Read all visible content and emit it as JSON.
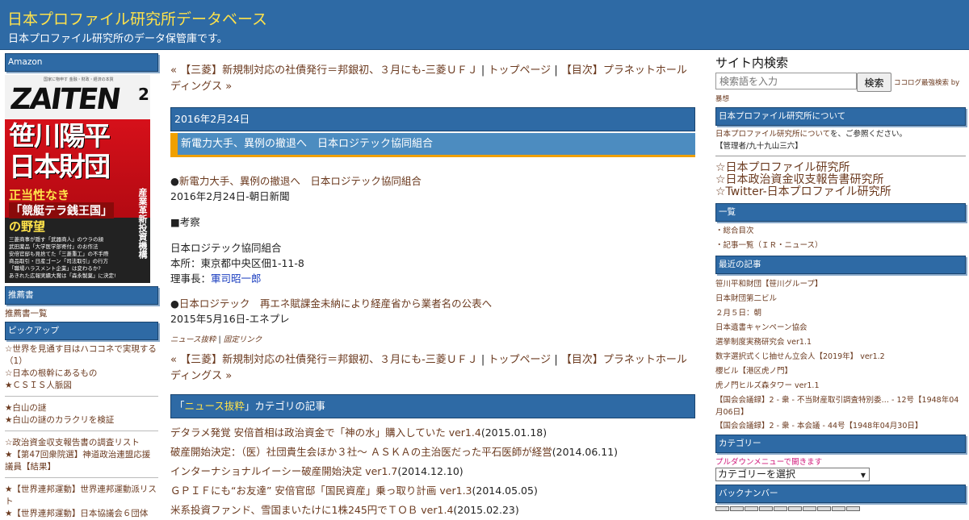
{
  "header": {
    "title": "日本プロファイル研究所データベース",
    "description": "日本プロファイル研究所のデータ保管庫です。"
  },
  "left": {
    "amazon_heading": "Amazon",
    "book": {
      "masthead": "ZAITEN",
      "masthead_small": "国家に物申す 金融・財政・経済の本質",
      "issue": "2",
      "headline1": "笹川陽平",
      "headline2": "日本財団",
      "sub1": "正当性なき",
      "sub2": "「競艇テラ銭王国」",
      "sub3": "の野望",
      "side": "産業革新投資機構",
      "lines": [
        "三菱商事が隠す「武器商人」のウラの顔",
        "武田薬品「大学医学部寄付」のお作法",
        "安倍官邸も見捨てた「三菱重工」の不手際",
        "商品取引・日産ゴーン「司法取引」の行方",
        "「職場ハラスメント企業」は変わるか?",
        "あきれた広報実績大賞は「森永製菓」に決定!"
      ]
    },
    "recommend_heading": "推薦書",
    "recommend_link": "推薦書一覧",
    "pickup_heading": "ピックアップ",
    "pickup_groups": [
      [
        "☆世界を見通す目はハココネで実現する（1）",
        "☆日本の根幹にあるもの",
        "★ＣＳＩＳ人脈図"
      ],
      [
        "★白山の謎",
        "★白山の謎のカラクリを検証"
      ],
      [
        "☆政治資金収支報告書の調査リスト",
        "★【第47回衆院選】神道政治連盟応援議員【結果】"
      ],
      [
        "★【世界連邦運動】世界連邦運動派リスト",
        "★【世界連邦運動】日本協議会６団体"
      ]
    ]
  },
  "main": {
    "nav": {
      "prev": "« 【三菱】新規制対応の社債発行＝邦銀初、３月にも-三菱ＵＦＪ",
      "sep": " | ",
      "top": "トップページ",
      "next": "【目次】プラネットホールディングス »"
    },
    "date": "2016年2月24日",
    "article_title": "新電力大手、異例の撤退へ　日本ロジテック協同組合",
    "body": {
      "bullet1_mark": "●",
      "bullet1_link": "新電力大手、異例の撤退へ　日本ロジテック協同組合",
      "source1": "2016年2月24日-朝日新聞",
      "consider": "■考察",
      "org": "日本ロジテック協同組合",
      "address": "本所：東京都中央区佃1-11-8",
      "chairman_label": "理事長：",
      "chairman_name": "軍司昭一郎",
      "bullet2_mark": "●",
      "bullet2_link": "日本ロジテック　再エネ賦課金未納により経産省から業者名の公表へ",
      "source2": "2015年5月16日-エネプレ"
    },
    "footer_links": {
      "category": "ニュース抜粋",
      "sep": " | ",
      "permalink": "固定リンク"
    },
    "category_bar": {
      "open": "「",
      "category": "ニュース抜粋",
      "rest": "」カテゴリの記事"
    },
    "category_articles": [
      {
        "title": "デタラメ発覚 安倍首相は政治資金で「神の水」購入していた ver1.4",
        "date": "(2015.01.18)"
      },
      {
        "title": "破産開始決定：（医）社団貴生会ほか３社～ ＡＳＫＡの主治医だった平石医師が経営",
        "date": "(2014.06.11)"
      },
      {
        "title": "インターナショナルイーシー破産開始決定 ver1.7",
        "date": "(2014.12.10)"
      },
      {
        "title": "ＧＰＩＦにも“お友達” 安倍官邸「国民資産」乗っ取り計画 ver1.3",
        "date": "(2014.05.05)"
      },
      {
        "title": "米系投資ファンド、雪国まいたけに1株245円でＴＯＢ ver1.4",
        "date": "(2015.02.23)"
      }
    ]
  },
  "right": {
    "search_title": "サイト内検索",
    "search_placeholder": "検索語を入力",
    "search_button": "検索",
    "search_credit": "ココログ最強検索 by",
    "search_credit2": "暴想",
    "about_heading": "日本プロファイル研究所について",
    "about_text_link": "日本プロファイル研究所について",
    "about_text_rest": "を、ご参照ください。",
    "admin": "【管理者/九十九山三六】",
    "big_links": [
      "☆日本プロファイル研究所",
      "☆日本政治資金収支報告書研究所",
      "☆Twitter-日本プロファイル研究所"
    ],
    "index_heading": "一覧",
    "index_links": [
      "・総合目次",
      "・記事一覧（ＩＲ・ニュース）"
    ],
    "recent_heading": "最近の記事",
    "recent_articles": [
      "笹川平和財団【笹川グループ】",
      "日本財団第二ビル",
      "２月５日：朝",
      "日本遺書キャンペーン協会",
      "選挙制度実務研究会 ver1.1",
      "数字選択式くじ抽せん立会人【2019年】 ver1.2",
      "櫻ビル【港区虎ノ門】",
      "虎ノ門ヒルズ森タワー ver1.1"
    ],
    "recent_wrapped": [
      "【国会会議録】2 - 衆 - 不当財産取引調査特別委… - 12号【1948年04月06日】",
      "【国会会議録】2 - 衆 - 本会議 - 44号【1948年04月30日】"
    ],
    "category_heading": "カテゴリー",
    "category_hint": "プルダウンメニューで開きます",
    "category_select": "カテゴリーを選択",
    "backnumber_heading": "バックナンバー"
  }
}
